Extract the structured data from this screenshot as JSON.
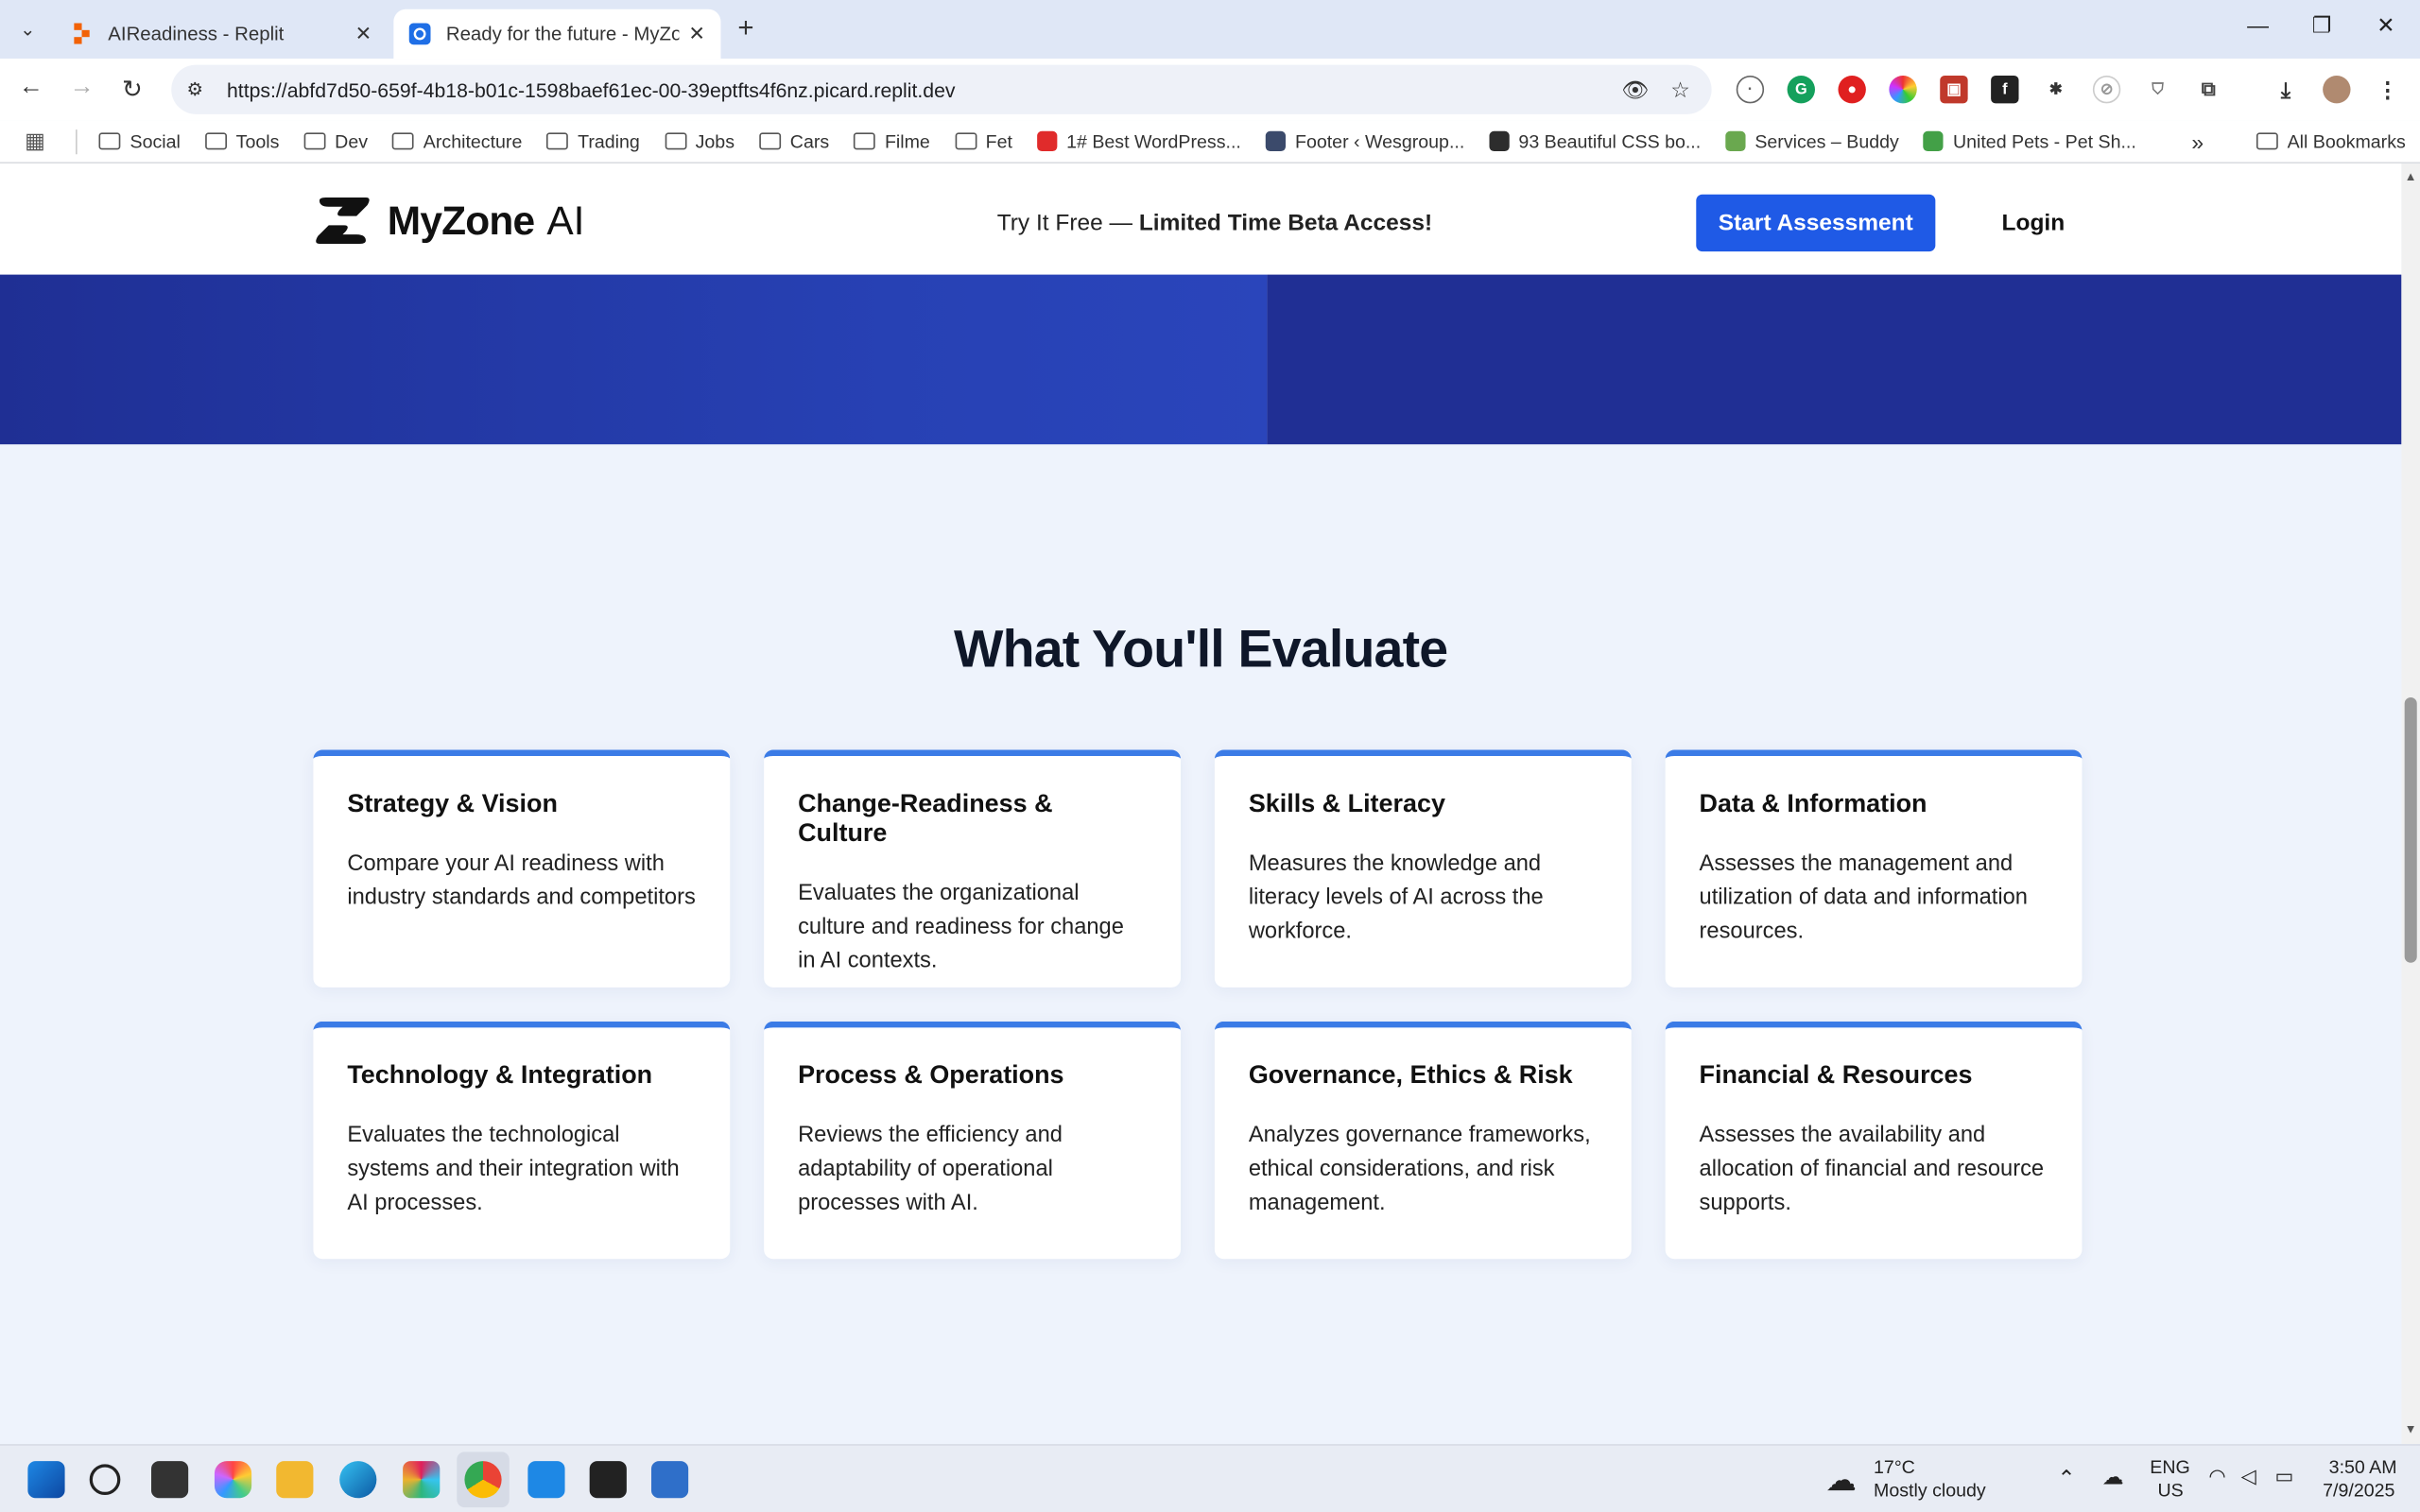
{
  "browser": {
    "tabs": [
      {
        "title": "AIReadiness - Replit",
        "active": false
      },
      {
        "title": "Ready for the future - MyZone AI",
        "active": true
      }
    ],
    "url": "https://abfd7d50-659f-4b18-b01c-1598baef61ec-00-39eptfts4f6nz.picard.replit.dev",
    "bookmarks": [
      {
        "label": "Social",
        "type": "folder"
      },
      {
        "label": "Tools",
        "type": "folder"
      },
      {
        "label": "Dev",
        "type": "folder"
      },
      {
        "label": "Architecture",
        "type": "folder"
      },
      {
        "label": "Trading",
        "type": "folder"
      },
      {
        "label": "Jobs",
        "type": "folder"
      },
      {
        "label": "Cars",
        "type": "folder"
      },
      {
        "label": "Filme",
        "type": "folder"
      },
      {
        "label": "Fet",
        "type": "folder"
      },
      {
        "label": "1# Best WordPress...",
        "type": "site",
        "color": "#e02b2b"
      },
      {
        "label": "Footer ‹ Wesgroup...",
        "type": "site",
        "color": "#3b4a6b"
      },
      {
        "label": "93 Beautiful CSS bo...",
        "type": "site",
        "color": "#2d2d2d"
      },
      {
        "label": "Services – Buddy",
        "type": "site",
        "color": "#6aa84f"
      },
      {
        "label": "United Pets - Pet Sh...",
        "type": "site",
        "color": "#43a047"
      }
    ],
    "all_bookmarks": "All Bookmarks"
  },
  "site": {
    "logo_text": "MyZone",
    "logo_suffix": "AI",
    "promo_prefix": "Try It Free — ",
    "promo_bold": "Limited Time Beta Access!",
    "cta_label": "Start Assessment",
    "login_label": "Login",
    "section_title": "What You'll Evaluate",
    "cards": [
      {
        "title": "Strategy & Vision",
        "desc": "Compare your AI readiness with industry standards and competitors"
      },
      {
        "title": "Change-Readiness & Culture",
        "desc": "Evaluates the organizational culture and readiness for change in AI contexts."
      },
      {
        "title": "Skills & Literacy",
        "desc": "Measures the knowledge and literacy levels of AI across the workforce."
      },
      {
        "title": "Data & Information",
        "desc": "Assesses the management and utilization of data and information resources."
      },
      {
        "title": "Technology & Integration",
        "desc": "Evaluates the technological systems and their integration with AI processes."
      },
      {
        "title": "Process & Operations",
        "desc": "Reviews the efficiency and adaptability of operational processes with AI."
      },
      {
        "title": "Governance, Ethics & Risk",
        "desc": "Analyzes governance frameworks, ethical considerations, and risk management."
      },
      {
        "title": "Financial & Resources",
        "desc": "Assesses the availability and allocation of financial and resource supports."
      }
    ],
    "colors": {
      "accent": "#1f5ae6",
      "card_border": "#3b7be6",
      "hero": "#202f94"
    }
  },
  "taskbar": {
    "weather_temp": "17°C",
    "weather_desc": "Mostly cloudy",
    "lang_1": "ENG",
    "lang_2": "US",
    "time": "3:50 AM",
    "date": "7/9/2025"
  }
}
